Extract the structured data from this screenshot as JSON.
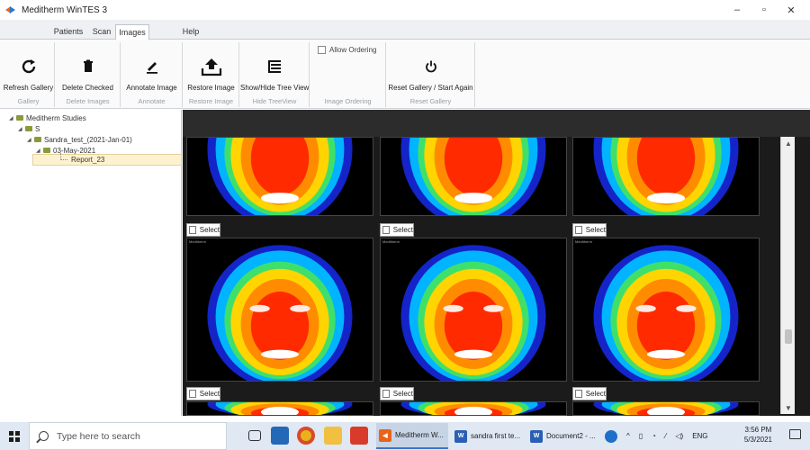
{
  "window": {
    "title": "Meditherm WinTES 3",
    "controls": {
      "minimize": "–",
      "maximize": "▫",
      "close": "✕"
    }
  },
  "ribbon_tabs": [
    {
      "label": "Patients",
      "active": false
    },
    {
      "label": "Scan",
      "active": false
    },
    {
      "label": "Images",
      "active": true
    },
    {
      "label": "Help",
      "active": false
    }
  ],
  "ribbon": {
    "refresh": {
      "label": "Refresh Gallery",
      "group": "Gallery",
      "icon": "refresh-icon"
    },
    "delete": {
      "label": "Delete Checked",
      "group": "Delete Images",
      "icon": "trash-icon"
    },
    "annotate": {
      "label": "Annotate Image",
      "group": "Annotate",
      "icon": "pen-icon"
    },
    "restore": {
      "label": "Restore Image",
      "group": "Restore Image",
      "icon": "upload-icon"
    },
    "treeview": {
      "label": "Show/Hide Tree View",
      "group": "Hide TreeView",
      "icon": "tree-list-icon"
    },
    "ordering": {
      "checkbox_label": "Allow Ordering",
      "checked": false,
      "group": "Image Ordering"
    },
    "reset": {
      "label": "Reset Gallery / Start Again",
      "group": "Reset Gallery",
      "icon": "power-icon"
    }
  },
  "tree": {
    "root": "Meditherm Studies",
    "patient": "S",
    "study": "Sandra_test_(2021-Jan-01)",
    "date": "03-May-2021",
    "report": "Report_23"
  },
  "gallery": {
    "select_label": "Select",
    "thumb_tag": "Meditherm",
    "colors": {
      "background": "#1b1b1b",
      "hot": "#ff2a00",
      "warm": "#ffd400",
      "cool": "#00b4ff",
      "cold": "#1424c8"
    }
  },
  "taskbar": {
    "search_placeholder": "Type here to search",
    "apps": [
      {
        "label": "Meditherm W...",
        "icon": "meditherm-icon",
        "active": true
      },
      {
        "label": "sandra first te...",
        "icon": "word-icon",
        "active": false
      },
      {
        "label": "Document2 - ...",
        "icon": "word-icon",
        "active": false
      }
    ],
    "language": "ENG",
    "time": "3:56 PM",
    "date": "5/3/2021"
  }
}
